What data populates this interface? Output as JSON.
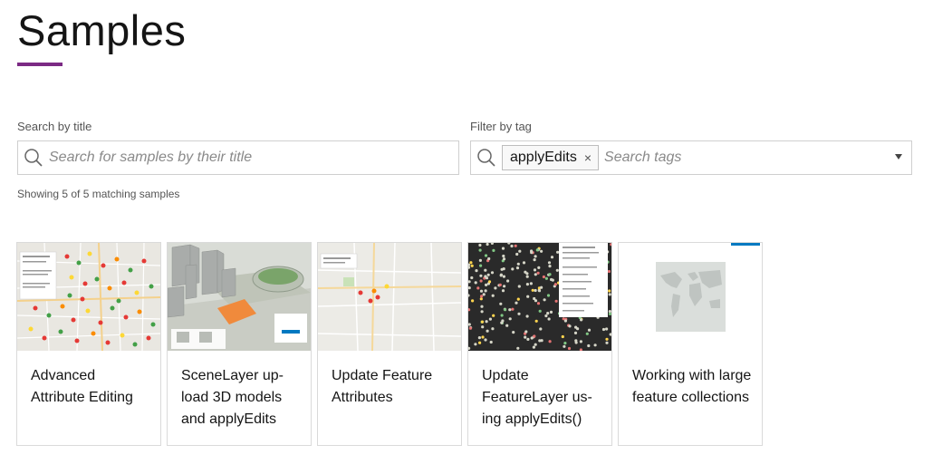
{
  "page": {
    "title": "Samples"
  },
  "colors": {
    "accent": "#7b2a84",
    "badge": "#0079c1"
  },
  "search": {
    "label": "Search by title",
    "placeholder": "Search for samples by their title"
  },
  "tag_filter": {
    "label": "Filter by tag",
    "selected_tag": "applyEdits",
    "remove_symbol": "×",
    "placeholder": "Search tags"
  },
  "results": {
    "summary": "Showing 5 of 5 matching samples"
  },
  "samples": [
    {
      "title": "Advanced Attribute Editing",
      "thumbnail": "map-with-colored-markers"
    },
    {
      "title": "SceneLayer up-load 3D models and applyEdits",
      "thumbnail": "3d-buildings-scene"
    },
    {
      "title": "Update Feature Attributes",
      "thumbnail": "street-map-with-markers"
    },
    {
      "title": "Update FeatureLayer us-ing applyEdits()",
      "thumbnail": "dark-map-with-dense-points"
    },
    {
      "title": "Working with large feature collections",
      "thumbnail": "world-map"
    }
  ]
}
